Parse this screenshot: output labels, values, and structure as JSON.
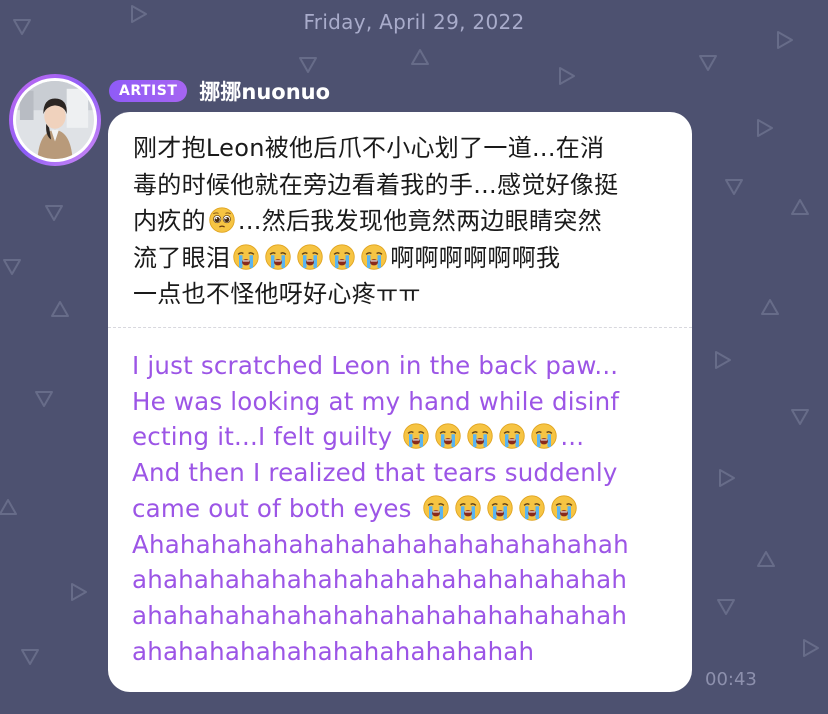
{
  "date_header": "Friday, April 29, 2022",
  "sender": {
    "badge": "ARTIST",
    "name": "挪挪nuonuo"
  },
  "message": {
    "original_lines": [
      "刚才抱Leon被他后爪不小心划了一道...在消",
      "毒的时候他就在旁边看着我的手...感觉好像挺",
      [
        "内疚的",
        "pleading-face-emoji",
        "...然后我发现他竟然两边眼睛突然"
      ],
      [
        "流了眼泪",
        "crying-face-emoji",
        "crying-face-emoji",
        "crying-face-emoji",
        "crying-face-emoji",
        "crying-face-emoji",
        "啊啊啊啊啊啊我"
      ],
      "一点也不怪他呀好心疼ㅠㅠ"
    ],
    "translated_lines": [
      "I just scratched Leon in the back paw...",
      "He was looking at my hand while disinf",
      [
        "ecting it...I felt guilty ",
        "crying-face-emoji",
        "crying-face-emoji",
        "crying-face-emoji",
        "crying-face-emoji",
        "crying-face-emoji",
        "..."
      ],
      "And then I realized that tears suddenly",
      [
        "came out of both eyes ",
        "crying-face-emoji",
        "crying-face-emoji",
        "crying-face-emoji",
        "crying-face-emoji",
        "crying-face-emoji"
      ],
      "Ahahahahahahahahahahahahahahahah",
      "ahahahahahahahahahahahahahahahah",
      "ahahahahahahahahahahahahahahahah",
      "ahahahahahahahahahahahahah"
    ],
    "time": "00:43"
  },
  "colors": {
    "background": "#4d5170",
    "bubble": "#ffffff",
    "original_text": "#1a1a1a",
    "translated_text": "#9c55e6",
    "badge": "#8f5bf7",
    "date_text": "#a9accb",
    "time_text": "#8d90ad"
  }
}
